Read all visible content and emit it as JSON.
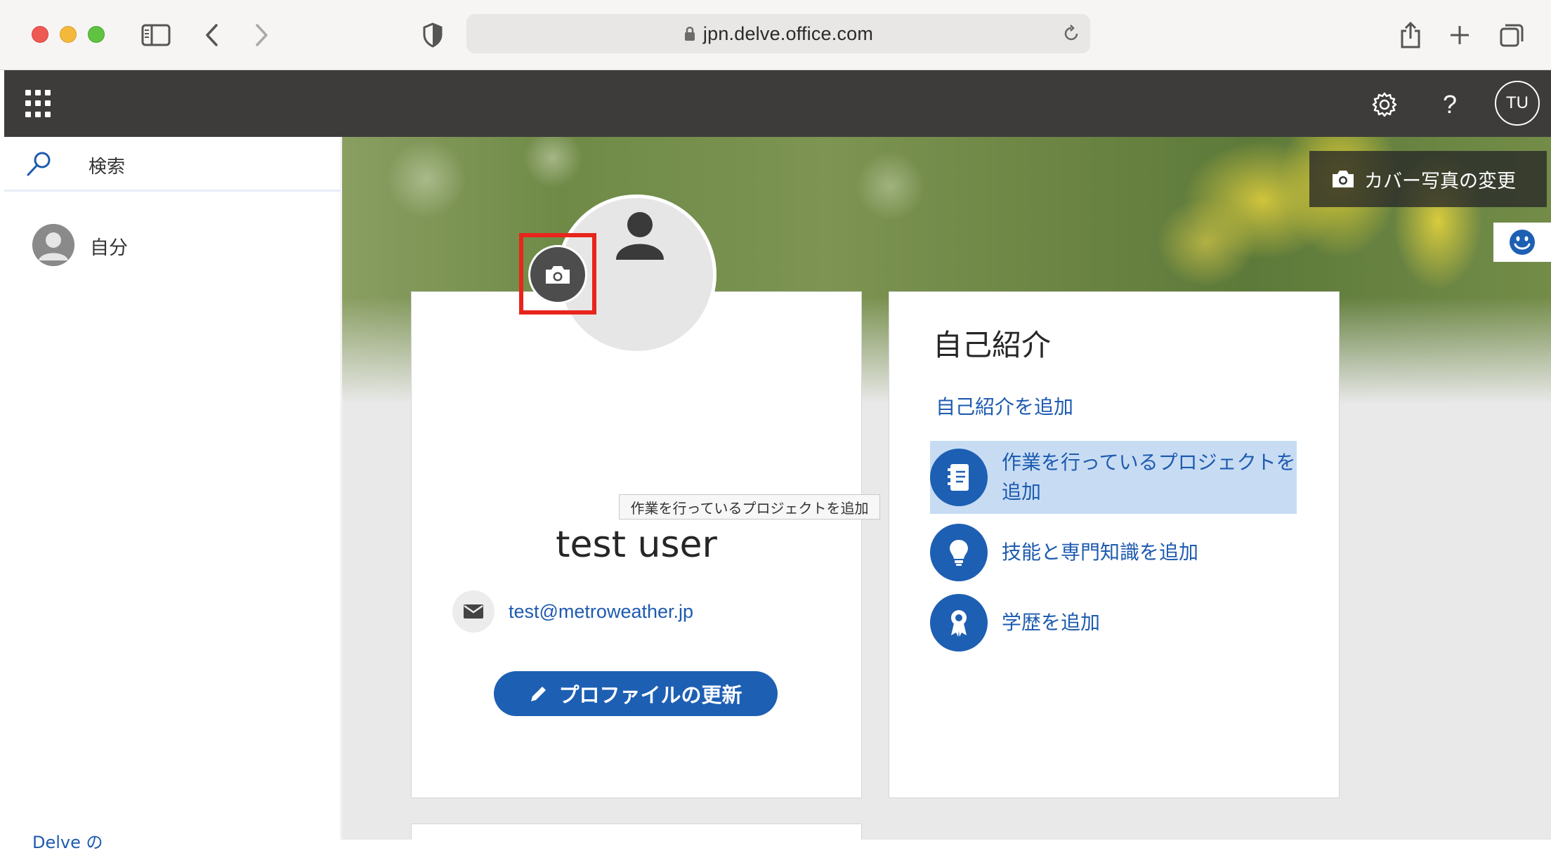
{
  "browser": {
    "url": "jpn.delve.office.com"
  },
  "suite_bar": {
    "avatar_initials": "TU",
    "help_label": "?"
  },
  "left_nav": {
    "search_label": "検索",
    "me_label": "自分",
    "bottom_link": "Delve の"
  },
  "cover": {
    "change_photo_label": "カバー写真の変更"
  },
  "profile": {
    "name": "test user",
    "email": "test@metroweather.jp",
    "update_button_label": "プロファイルの更新"
  },
  "tooltip": {
    "text": "作業を行っているプロジェクトを追加"
  },
  "about": {
    "title": "自己紹介",
    "add_link": "自己紹介を追加",
    "items": [
      {
        "label": "作業を行っているプロジェクトを追加",
        "icon": "notebook-icon"
      },
      {
        "label": "技能と専門知識を追加",
        "icon": "lightbulb-icon"
      },
      {
        "label": "学歴を追加",
        "icon": "ribbon-icon"
      }
    ]
  },
  "colors": {
    "accent": "#1d5fb3",
    "suite_bar": "#3d3c3b",
    "highlight_box": "#e8251c",
    "item_highlight": "#c7dcf3"
  }
}
